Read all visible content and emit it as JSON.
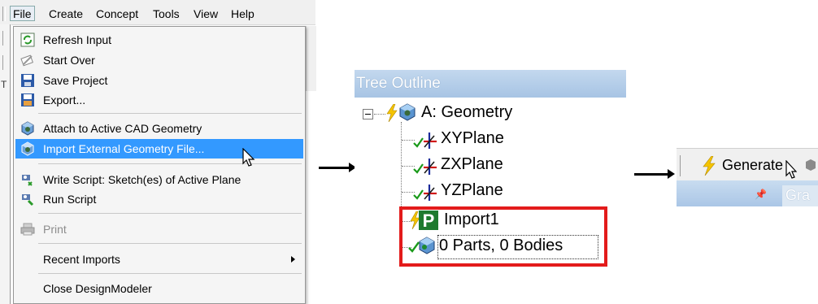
{
  "menubar": {
    "items": [
      "File",
      "Create",
      "Concept",
      "Tools",
      "View",
      "Help"
    ]
  },
  "leftstrip_letter": "T",
  "file_menu": {
    "items": [
      {
        "label": "Refresh Input",
        "icon": "refresh-icon"
      },
      {
        "label": "Start Over",
        "icon": "start-over-icon"
      },
      {
        "label": "Save Project",
        "icon": "save-icon"
      },
      {
        "label": "Export...",
        "icon": "export-icon"
      },
      {
        "label": "Attach to Active CAD Geometry",
        "icon": "attach-cad-icon"
      },
      {
        "label": "Import External Geometry File...",
        "icon": "import-geometry-icon",
        "highlighted": true
      },
      {
        "label": "Write Script: Sketch(es) of Active Plane",
        "icon": "write-script-icon"
      },
      {
        "label": "Run Script",
        "icon": "run-script-icon"
      },
      {
        "label": "Print",
        "icon": "print-icon",
        "disabled": true
      },
      {
        "label": "Recent Imports",
        "submenu": true
      },
      {
        "label": "Close DesignModeler"
      }
    ]
  },
  "tree": {
    "header": "Tree Outline",
    "root": "A: Geometry",
    "children": [
      "XYPlane",
      "ZXPlane",
      "YZPlane",
      "Import1",
      "0 Parts, 0 Bodies"
    ]
  },
  "toolbar": {
    "generate_label": "Generate",
    "tab_label": "Gra"
  },
  "colors": {
    "menu_highlight": "#3399ff",
    "header_blue": "#a7c4e4",
    "highlight_box": "#e31b1b",
    "check_green": "#1a9a1a",
    "lightning": "#f5c400"
  }
}
